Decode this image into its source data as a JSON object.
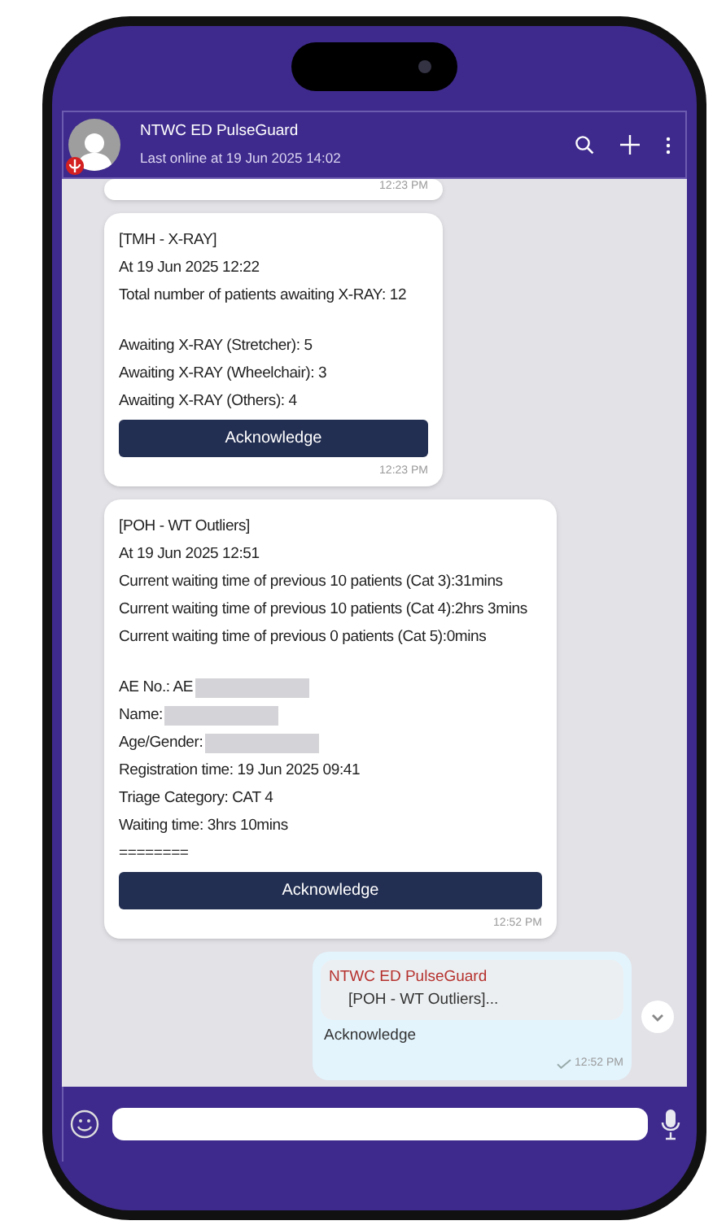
{
  "header": {
    "name": "NTWC ED PulseGuard",
    "status": "Last online at 19 Jun 2025 14:02"
  },
  "messages": [
    {
      "kind": "incoming",
      "time": "12:23 PM"
    },
    {
      "kind": "incoming",
      "paragraphs": [
        [
          {
            "text": "[TMH - X-RAY]"
          },
          {
            "text": "At 19 Jun 2025 12:22"
          },
          {
            "text": "Total number of patients awaiting X-RAY: 12"
          }
        ],
        [
          {
            "text": "Awaiting X-RAY (Stretcher): 5"
          },
          {
            "text": "Awaiting X-RAY (Wheelchair): 3"
          },
          {
            "text": "Awaiting X-RAY (Others): 4"
          }
        ]
      ],
      "button": "Acknowledge",
      "time": "12:23 PM"
    },
    {
      "kind": "incoming",
      "paragraphs": [
        [
          {
            "text": "[POH - WT Outliers]"
          },
          {
            "text": "At 19 Jun 2025 12:51"
          },
          {
            "text": "Current waiting time of previous 10 patients (Cat 3):31mins"
          },
          {
            "text": "Current waiting time of previous 10 patients (Cat 4):2hrs 3mins"
          },
          {
            "text": "Current waiting time of previous 0 patients (Cat 5):0mins"
          }
        ],
        [
          {
            "text": "AE No.: AE",
            "redacted": true
          },
          {
            "text": "Name:",
            "redacted": true
          },
          {
            "text": "Age/Gender:",
            "redacted": true
          },
          {
            "text": "Registration time:  19 Jun 2025 09:41"
          },
          {
            "text": "Triage Category: CAT 4"
          },
          {
            "text": "Waiting time: 3hrs 10mins"
          },
          {
            "text": "========"
          }
        ]
      ],
      "button": "Acknowledge",
      "time": "12:52 PM",
      "wide": true
    },
    {
      "kind": "outgoing",
      "quote": {
        "author": "NTWC ED PulseGuard",
        "text": "[POH - WT Outliers]..."
      },
      "text": "Acknowledge",
      "time": "12:52 PM",
      "read": true
    }
  ]
}
